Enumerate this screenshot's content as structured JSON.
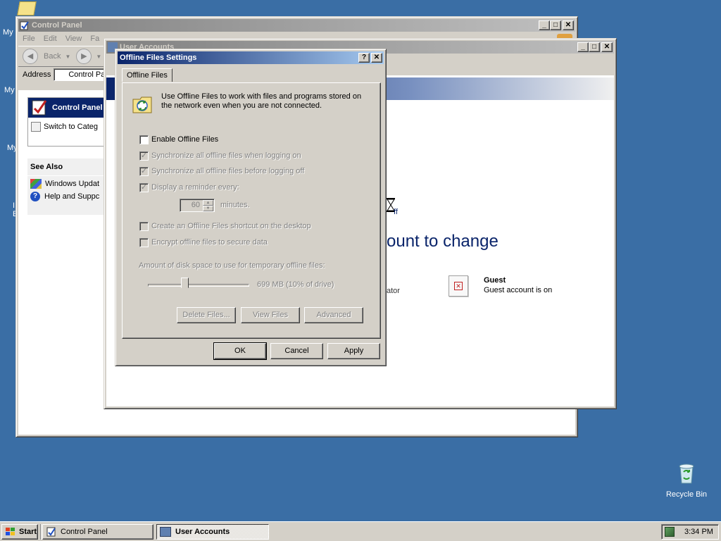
{
  "desktop": {
    "recycle_bin_label": "Recycle Bin",
    "fragments": [
      "My",
      "My",
      "My",
      "I",
      "E"
    ]
  },
  "control_panel": {
    "title": "Control Panel",
    "menu": [
      "File",
      "Edit",
      "View",
      "Fa"
    ],
    "back_label": "Back",
    "address_label": "Address",
    "address_value": "Control Pa",
    "panel_title": "Control Panel",
    "switch_label": "Switch to Categ",
    "see_also": "See Also",
    "links": [
      "Windows Updat",
      "Help and Suppc"
    ]
  },
  "user_accounts": {
    "title": "User Accounts",
    "heading_fragment": "ount to change",
    "off_fragment": "ff",
    "admin_fragment": "ator",
    "guest_name": "Guest",
    "guest_status": "Guest account is on"
  },
  "dialog": {
    "title": "Offline Files Settings",
    "tab_label": "Offline Files",
    "description": "Use Offline Files to work with files and programs stored on the network even when you are not connected.",
    "enable_label": "Enable Offline Files",
    "enable_checked": false,
    "sync_logon_label": "Synchronize all offline files when logging on",
    "sync_logoff_label": "Synchronize all offline files before logging off",
    "reminder_label": "Display a reminder every:",
    "reminder_minutes": "60",
    "minutes_label": "minutes.",
    "shortcut_label": "Create an Offline Files shortcut on the desktop",
    "encrypt_label": "Encrypt offline files to secure data",
    "disk_space_label": "Amount of disk space to use for temporary offline files:",
    "disk_space_value": "699 MB (10% of drive)",
    "disk_space_fraction": 0.1,
    "delete_files": "Delete Files...",
    "view_files": "View Files",
    "advanced": "Advanced",
    "ok": "OK",
    "cancel": "Cancel",
    "apply": "Apply",
    "help_glyph": "?",
    "close_glyph": "✕"
  },
  "taskbar": {
    "start": "Start",
    "items": [
      "Control Panel",
      "User Accounts"
    ],
    "clock": "3:34 PM"
  },
  "colors": {
    "desktop": "#3a6ea5",
    "active_title": "#0a246a",
    "inactive_title": "#808080"
  }
}
